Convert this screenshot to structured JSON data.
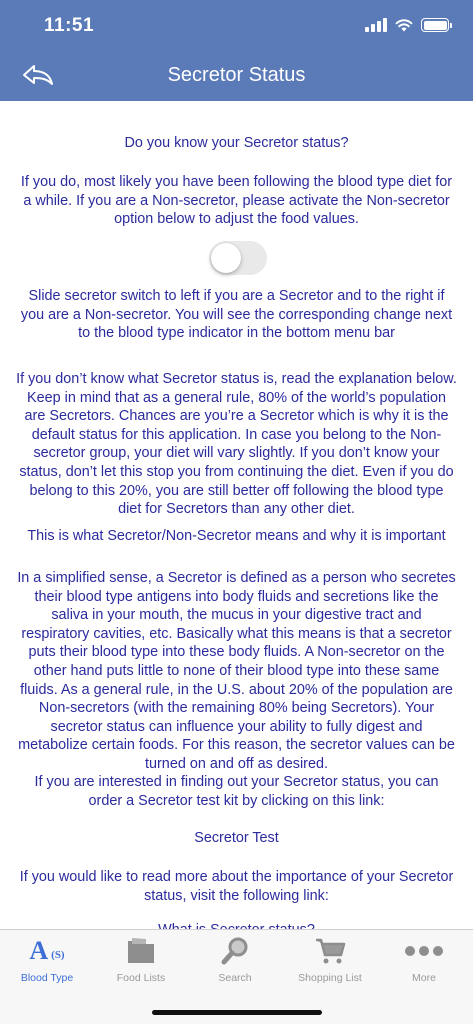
{
  "status_bar": {
    "time": "11:51"
  },
  "header": {
    "title": "Secretor Status"
  },
  "content": {
    "question": "Do you know your Secretor status?",
    "intro": "If you do, most likely you have been following the blood type diet for a while. If you are a Non-secretor, please activate the Non-secretor option below to adjust the food values.",
    "toggle_on": false,
    "slide_instruction": "Slide secretor switch to left if you are a Secretor and to the right if you are a Non-secretor. You will see the corresponding change next to the blood type indicator in the bottom menu bar",
    "unknown_status": "If you don’t know what Secretor status is, read the explanation below. Keep in mind that as a general rule, 80% of the world’s population are Secretors. Chances are you’re a Secretor which is why it is the default status for this application. In case you belong to the Non-secretor group, your diet will vary slightly. If you don’t know your status, don’t let this stop you from continuing the diet. Even if you do  belong to this 20%, you are still better off following the blood type diet for Secretors than any other diet.",
    "section_heading": "This is what Secretor/Non-Secretor means and why it is important",
    "explanation": "In a simplified sense, a Secretor is defined as a person who secretes their blood type antigens into body fluids and secretions like the saliva in your mouth, the mucus in your digestive tract and respiratory cavities, etc. Basically what this means is that a secretor puts their blood type into these body fluids. A Non-secretor on the other hand puts little to none of their blood type into these same fluids. As a general rule, in the U.S. about 20% of the population are Non-secretors (with the remaining 80% being Secretors). Your secretor status can influence your ability to fully digest and metabolize certain foods. For this reason, the secretor values can be turned on and off as desired.",
    "test_kit": "If you are interested in finding out your Secretor status, you can order a Secretor test kit by clicking on this link:",
    "test_link": "Secretor Test",
    "read_more": "If you would like to read more about the importance of your Secretor status, visit the following link:",
    "read_more_link": "What is Secretor status?"
  },
  "tabbar": {
    "items": [
      {
        "label": "Blood Type",
        "active": true,
        "icon": "blood-type-icon",
        "icon_text": "A",
        "icon_sub": "(S)"
      },
      {
        "label": "Food Lists",
        "active": false,
        "icon": "folder-icon"
      },
      {
        "label": "Search",
        "active": false,
        "icon": "magnifier-icon"
      },
      {
        "label": "Shopping List",
        "active": false,
        "icon": "cart-icon"
      },
      {
        "label": "More",
        "active": false,
        "icon": "ellipsis-icon"
      }
    ]
  },
  "colors": {
    "header_bg": "#5a7ab8",
    "body_text": "#2b2b9e",
    "tab_active": "#3d6fd6",
    "tab_inactive": "#9a9a9a"
  }
}
